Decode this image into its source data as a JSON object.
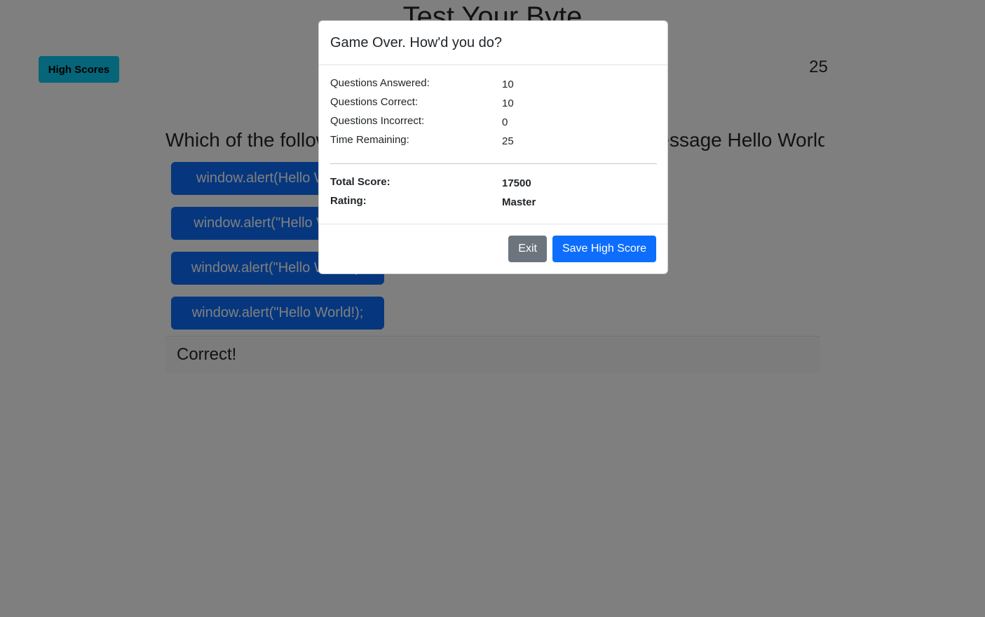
{
  "app": {
    "title": "Test Your Byte",
    "high_scores_label": "High Scores",
    "timer": "25"
  },
  "quiz": {
    "question": "Which of the following will display an alert box with the message Hello World?",
    "answers": [
      "window.alert(Hello World);",
      "window.alert(\"Hello World\";",
      "window.alert(\"Hello World\");",
      "window.alert(\"Hello World!);"
    ],
    "feedback": "Correct!"
  },
  "modal": {
    "title": "Game Over. How'd you do?",
    "stats": [
      {
        "label": "Questions Answered:",
        "value": "10"
      },
      {
        "label": "Questions Correct:",
        "value": "10"
      },
      {
        "label": "Questions Incorrect:",
        "value": "0"
      },
      {
        "label": "Time Remaining:",
        "value": "25"
      }
    ],
    "totals": [
      {
        "label": "Total Score:",
        "value": "17500"
      },
      {
        "label": "Rating:",
        "value": "Master"
      }
    ],
    "exit_label": "Exit",
    "save_label": "Save High Score"
  },
  "colors": {
    "primary": "#0d6efd",
    "info": "#0dcaf0",
    "secondary": "#6c757d",
    "backdrop": "rgba(0,0,0,0.5)"
  }
}
